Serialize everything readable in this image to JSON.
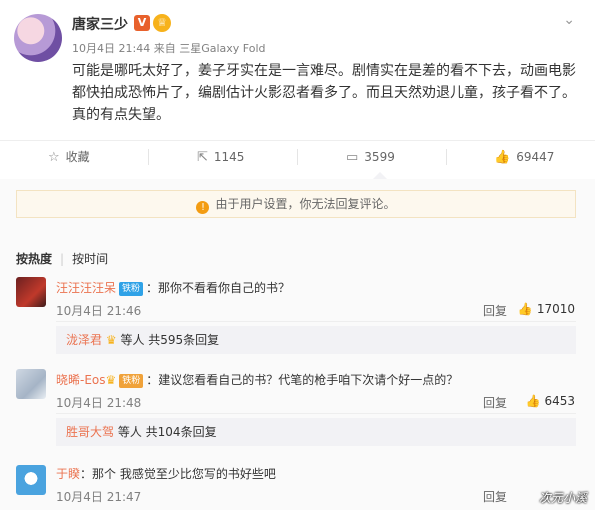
{
  "post": {
    "author": "唐家三少",
    "v_badge": "V",
    "crown": "♕",
    "time": "10月4日 21:44",
    "source": "来自 三星Galaxy Fold",
    "text": "可能是哪吒太好了，姜子牙实在是一言难尽。剧情实在是差的看不下去，动画电影都快拍成恐怖片了，编剧估计火影忍者看多了。而且天然劝退儿童，孩子看不了。真的有点失望。"
  },
  "actions": {
    "favorite_label": "收藏",
    "repost_count": "1145",
    "comment_count": "3599",
    "like_count": "69447"
  },
  "notice": {
    "text": "由于用户设置，你无法回复评论。",
    "icon": "!"
  },
  "sort": {
    "hot": "按热度",
    "time": "按时间"
  },
  "comments": [
    {
      "name": "汪汪汪汪呆",
      "badge": "铁粉",
      "text": "：那你不看看你自己的书？",
      "time": "10月4日 21:46",
      "reply": "回复",
      "likes": "17010",
      "sub_name": "泷泽君",
      "sub_text": "等人 共595条回复"
    },
    {
      "name": "晓晞-Eos",
      "badge": "铁粉",
      "text": "：建议您看看自己的书？代笔的枪手咱下次请个好一点的？",
      "time": "10月4日 21:48",
      "reply": "回复",
      "likes": "6453",
      "sub_name": "胜哥大驾",
      "sub_text": "等人 共104条回复"
    },
    {
      "name": "于睽",
      "text": "：那个 我感觉至少比您写的书好些吧",
      "time": "10月4日 21:47",
      "reply": "回复"
    }
  ],
  "watermark": "次元小溪",
  "colors": {
    "name": "#eb7350",
    "notice_bg": "#fdf8ee",
    "badge_fan": "#f0a23a"
  }
}
